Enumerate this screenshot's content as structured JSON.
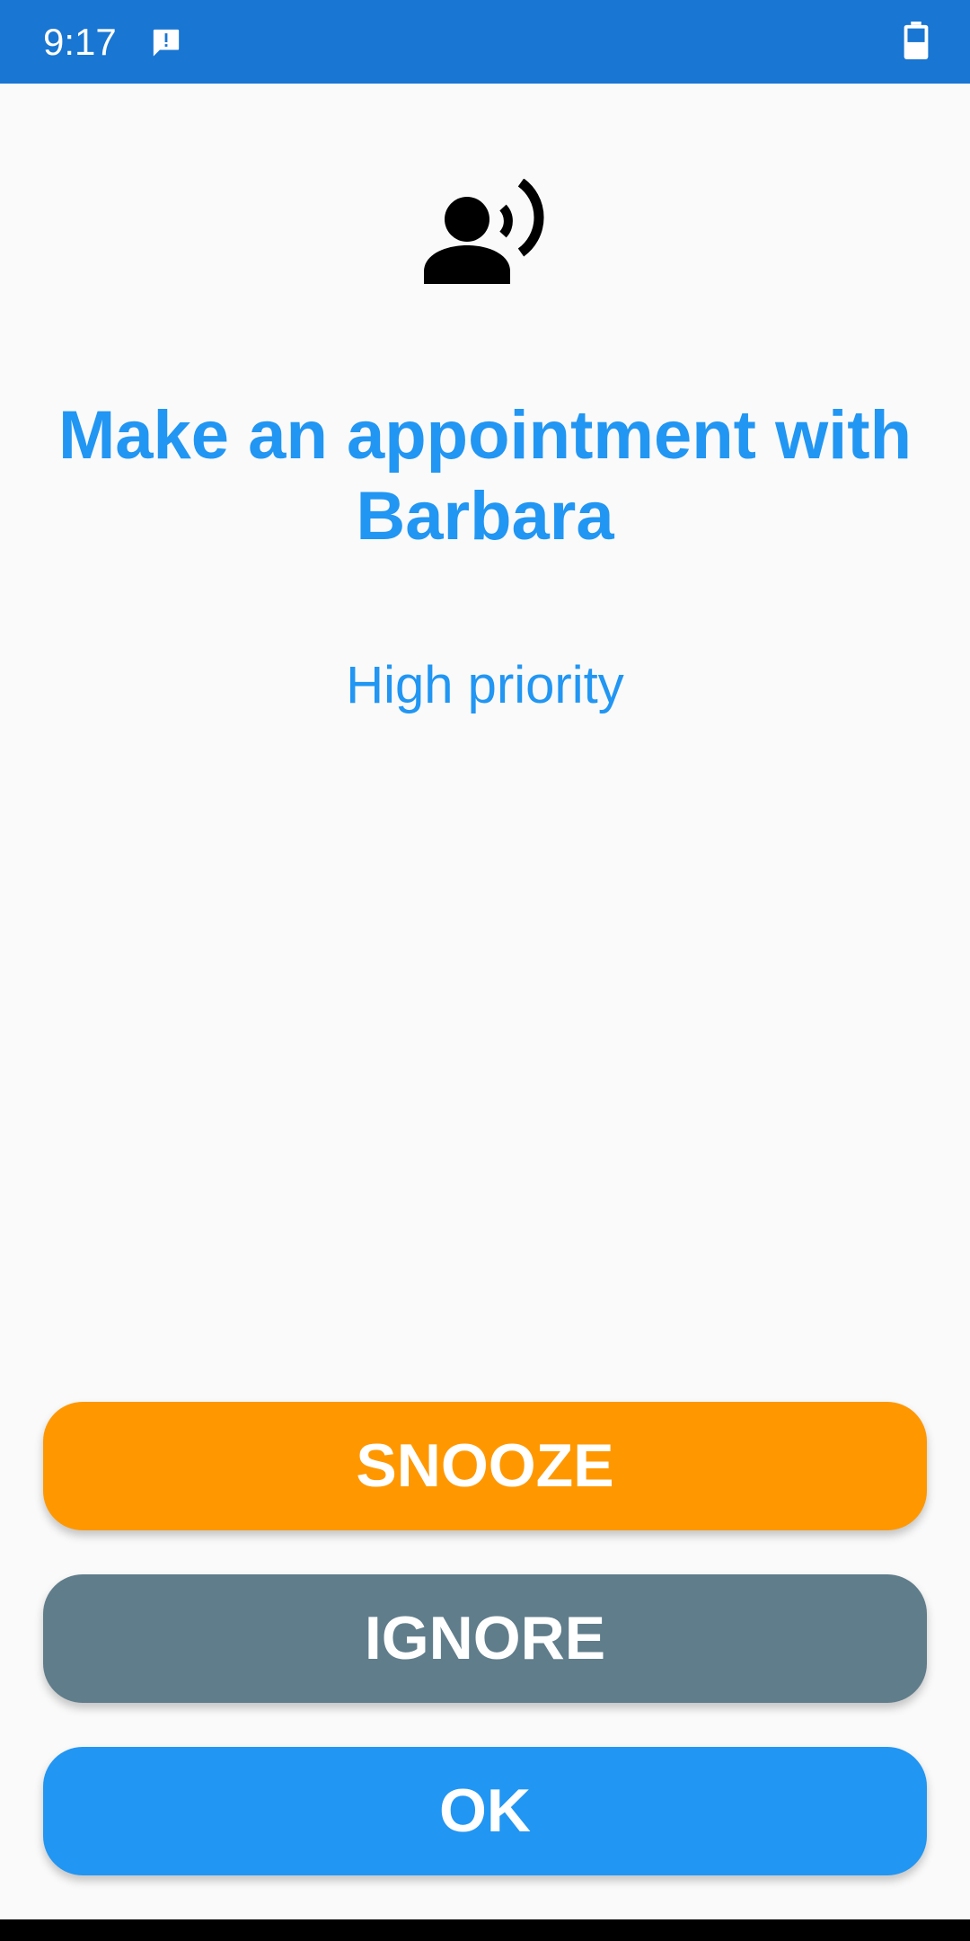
{
  "status_bar": {
    "time": "9:17",
    "color": "#1976d2",
    "icons": [
      "message-alert-icon",
      "battery-icon"
    ]
  },
  "reminder": {
    "icon": "person-speaking-icon",
    "title": "Make an appointment with Barbara",
    "priority": "High priority",
    "accent_color": "#2196f3"
  },
  "actions": {
    "snooze_label": "SNOOZE",
    "ignore_label": "IGNORE",
    "ok_label": "OK",
    "snooze_color": "#ff9800",
    "ignore_color": "#607d8b",
    "ok_color": "#2196f3"
  }
}
